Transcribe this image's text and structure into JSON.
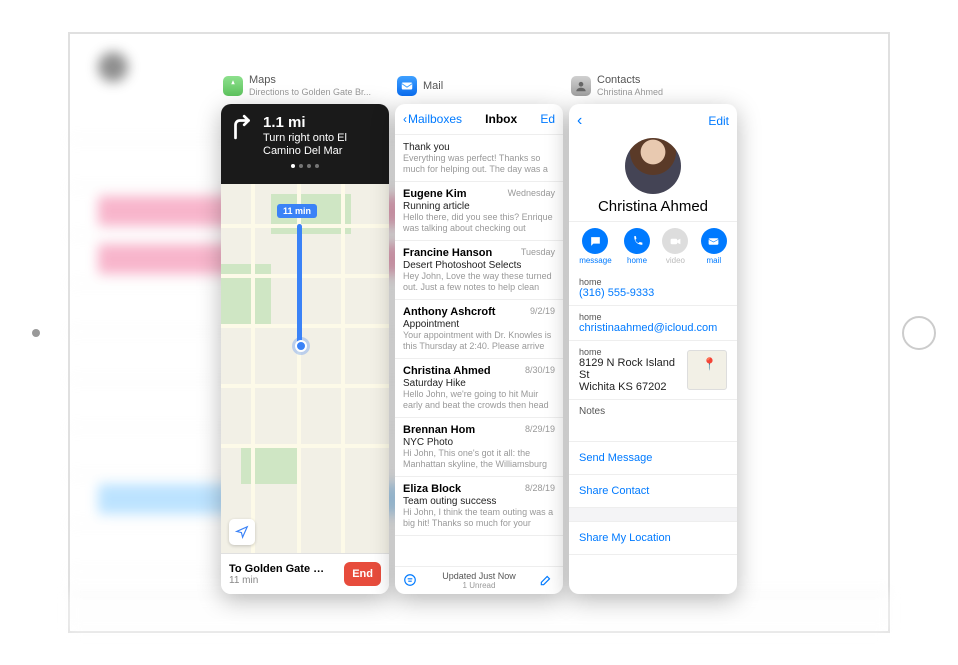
{
  "maps": {
    "app_title": "Maps",
    "app_subtitle": "Directions to Golden Gate Br...",
    "distance": "1.1 mi",
    "instruction": "Turn right onto El Camino Del Mar",
    "route_time": "11 min",
    "destination": "To Golden Gate B...",
    "dest_time": "11 min",
    "end_label": "End"
  },
  "mail": {
    "app_title": "Mail",
    "back_label": "Mailboxes",
    "title": "Inbox",
    "edit_label": "Ed",
    "status_line1": "Updated Just Now",
    "status_line2": "1 Unread",
    "messages": [
      {
        "from": "",
        "date": "",
        "subject": "Thank you",
        "preview": "Everything was perfect! Thanks so much for helping out. The day was a gr"
      },
      {
        "from": "Eugene Kim",
        "date": "Wednesday",
        "subject": "Running article",
        "preview": "Hello there, did you see this? Enrique was talking about checking out some..."
      },
      {
        "from": "Francine Hanson",
        "date": "Tuesday",
        "subject": "Desert Photoshoot Selects",
        "preview": "Hey John, Love the way these turned out. Just a few notes to help clean this"
      },
      {
        "from": "Anthony Ashcroft",
        "date": "9/2/19",
        "subject": "Appointment",
        "preview": "Your appointment with Dr. Knowles is this Thursday at 2:40. Please arrive by"
      },
      {
        "from": "Christina Ahmed",
        "date": "8/30/19",
        "subject": "Saturday Hike",
        "preview": "Hello John, we're going to hit Muir early and beat the crowds then head into to"
      },
      {
        "from": "Brennan Hom",
        "date": "8/29/19",
        "subject": "NYC Photo",
        "preview": "Hi John, This one's got it all: the Manhattan skyline, the Williamsburg B..."
      },
      {
        "from": "Eliza Block",
        "date": "8/28/19",
        "subject": "Team outing success",
        "preview": "Hi John, I think the team outing was a big hit! Thanks so much for your sugg..."
      }
    ]
  },
  "contacts": {
    "app_title": "Contacts",
    "app_subtitle": "Christina Ahmed",
    "edit_label": "Edit",
    "name": "Christina Ahmed",
    "actions": {
      "message": "message",
      "home": "home",
      "video": "video",
      "mail": "mail"
    },
    "info": {
      "phone_label": "home",
      "phone": "(316) 555-9333",
      "email_label": "home",
      "email": "christinaahmed@icloud.com",
      "address_label": "home",
      "address": "8129 N Rock Island St\nWichita KS 67202",
      "notes_label": "Notes"
    },
    "links": {
      "send_message": "Send Message",
      "share_contact": "Share Contact",
      "share_location": "Share My Location"
    }
  }
}
